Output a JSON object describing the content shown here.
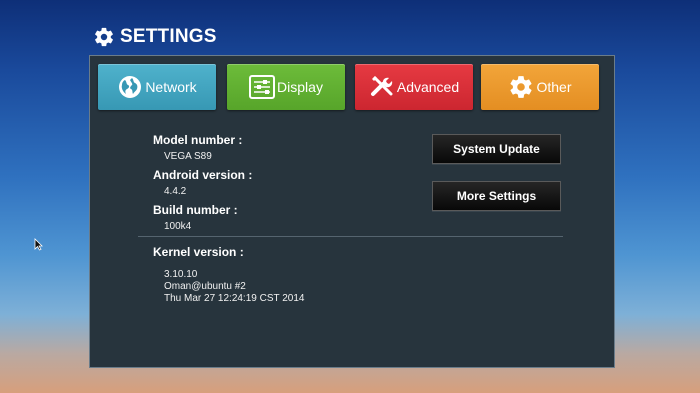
{
  "header": {
    "title": "SETTINGS",
    "icon": "gear-icon"
  },
  "tabs": [
    {
      "label": "Network",
      "icon": "globe-icon",
      "color": "#3fa4c0"
    },
    {
      "label": "Display",
      "icon": "sliders-icon",
      "color": "#62b132"
    },
    {
      "label": "Advanced",
      "icon": "tools-icon",
      "color": "#da2f38"
    },
    {
      "label": "Other",
      "icon": "gear-icon",
      "color": "#ec9a2c"
    }
  ],
  "info": {
    "model_label": "Model number :",
    "model_value": "VEGA S89",
    "android_label": "Android version :",
    "android_value": "4.4.2",
    "build_label": "Build number :",
    "build_value": "100k4"
  },
  "kernel": {
    "label": "Kernel version :",
    "lines": [
      "3.10.10",
      "Oman@ubuntu #2",
      "Thu Mar 27 12:24:19 CST 2014"
    ]
  },
  "buttons": {
    "system_update": "System Update",
    "more_settings": "More Settings"
  }
}
